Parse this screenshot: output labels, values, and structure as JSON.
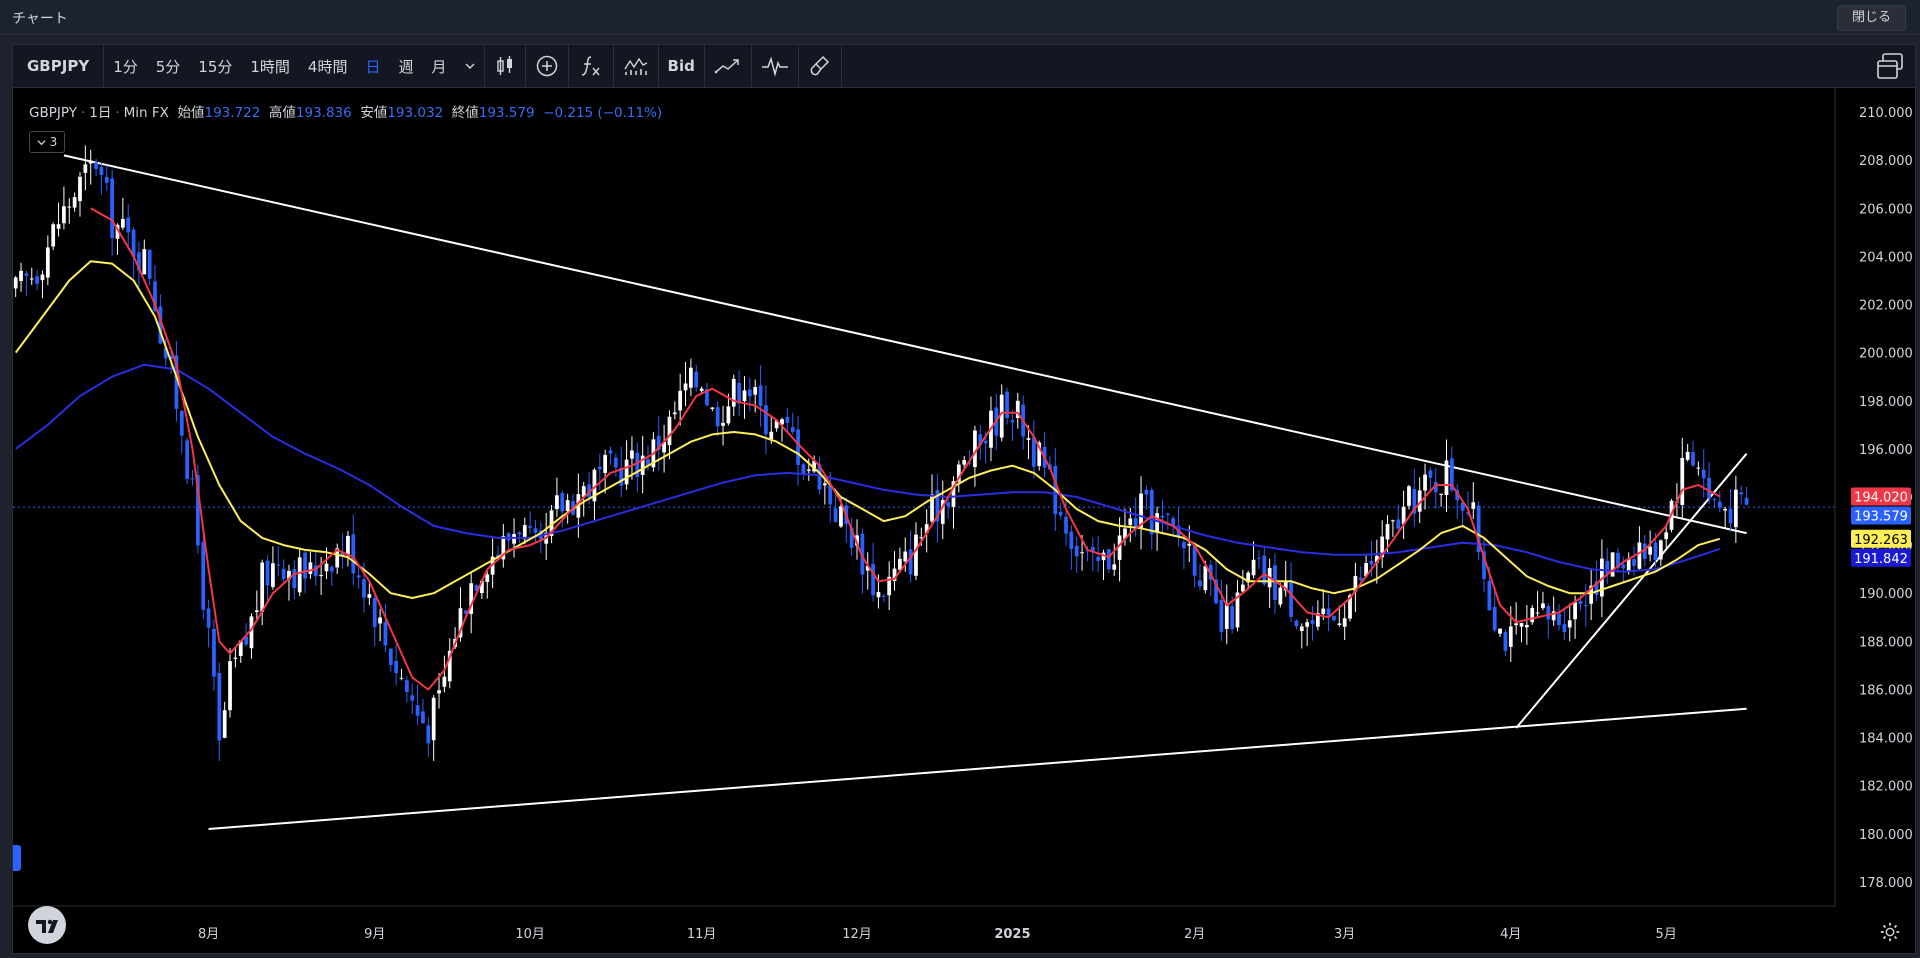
{
  "window": {
    "title": "チャート",
    "close_label": "閉じる"
  },
  "toolbar": {
    "symbol": "GBPJPY",
    "timeframes": [
      "1分",
      "5分",
      "15分",
      "1時間",
      "4時間",
      "日",
      "週",
      "月"
    ],
    "active_timeframe": "日",
    "bid_label": "Bid"
  },
  "legend": {
    "symbol": "GBPJPY",
    "interval": "1日",
    "source": "Min FX",
    "open_label": "始値",
    "open": "193.722",
    "high_label": "高値",
    "high": "193.836",
    "low_label": "安値",
    "low": "193.032",
    "close_label": "終値",
    "close": "193.579",
    "change": "−0.215 (−0.11%)",
    "collapse_count": "3"
  },
  "colors": {
    "up": "#ffffff",
    "down": "#2962ff",
    "ma_fast": "#f23645",
    "ma_mid": "#ffee58",
    "ma_slow": "#2a2ee0",
    "trendline": "#ffffff"
  },
  "chart_data": {
    "type": "candlestick",
    "y_range": [
      177.0,
      211.0
    ],
    "y_ticks": [
      "178.000",
      "180.000",
      "182.000",
      "184.000",
      "186.000",
      "188.000",
      "190.000",
      "192.000",
      "194.000",
      "196.000",
      "198.000",
      "200.000",
      "202.000",
      "204.000",
      "206.000",
      "208.000",
      "210.000"
    ],
    "x_ticks": [
      {
        "label": "7月",
        "bar": 5
      },
      {
        "label": "8月",
        "bar": 36
      },
      {
        "label": "9月",
        "bar": 67
      },
      {
        "label": "10月",
        "bar": 96
      },
      {
        "label": "11月",
        "bar": 128
      },
      {
        "label": "12月",
        "bar": 157
      },
      {
        "label": "2025",
        "bar": 186
      },
      {
        "label": "2月",
        "bar": 220
      },
      {
        "label": "3月",
        "bar": 248
      },
      {
        "label": "4月",
        "bar": 279
      },
      {
        "label": "5月",
        "bar": 308
      }
    ],
    "price_labels": [
      {
        "value": "194.020",
        "price": 194.02,
        "color": "#f23645",
        "text_color": "#ffffff"
      },
      {
        "value": "193.579",
        "price": 193.579,
        "color": "#2962ff",
        "text_color": "#ffffff"
      },
      {
        "value": "192.263",
        "price": 192.263,
        "color": "#ffee58",
        "text_color": "#000000"
      },
      {
        "value": "191.842",
        "price": 191.842,
        "color": "#1a1ad6",
        "text_color": "#ffffff"
      }
    ],
    "last_price": 193.579,
    "close_path": [
      [
        0,
        202.5
      ],
      [
        4,
        203.5
      ],
      [
        8,
        205.5
      ],
      [
        12,
        207.0
      ],
      [
        15,
        208.0
      ],
      [
        18,
        205.5
      ],
      [
        22,
        204.5
      ],
      [
        25,
        203.5
      ],
      [
        27,
        201.0
      ],
      [
        29,
        199.0
      ],
      [
        31,
        197.0
      ],
      [
        33,
        194.0
      ],
      [
        35,
        190.0
      ],
      [
        37,
        186.0
      ],
      [
        38,
        183.5
      ],
      [
        40,
        186.5
      ],
      [
        43,
        188.0
      ],
      [
        46,
        190.5
      ],
      [
        49,
        191.5
      ],
      [
        52,
        191.0
      ],
      [
        55,
        190.8
      ],
      [
        58,
        191.5
      ],
      [
        60,
        191.8
      ],
      [
        62,
        192.0
      ],
      [
        64,
        191.0
      ],
      [
        66,
        190.0
      ],
      [
        69,
        188.0
      ],
      [
        72,
        186.5
      ],
      [
        75,
        185.0
      ],
      [
        77,
        184.5
      ],
      [
        79,
        185.5
      ],
      [
        82,
        188.5
      ],
      [
        85,
        190.5
      ],
      [
        88,
        191.5
      ],
      [
        91,
        192.0
      ],
      [
        94,
        193.0
      ],
      [
        96,
        192.0
      ],
      [
        98,
        191.5
      ],
      [
        101,
        193.5
      ],
      [
        104,
        194.0
      ],
      [
        107,
        194.5
      ],
      [
        110,
        195.0
      ],
      [
        113,
        195.2
      ],
      [
        116,
        195.5
      ],
      [
        119,
        196.0
      ],
      [
        122,
        197.0
      ],
      [
        125,
        198.5
      ],
      [
        128,
        199.0
      ],
      [
        130,
        197.5
      ],
      [
        133,
        198.0
      ],
      [
        136,
        199.0
      ],
      [
        139,
        197.5
      ],
      [
        142,
        197.0
      ],
      [
        145,
        196.5
      ],
      [
        147,
        195.5
      ],
      [
        150,
        195.0
      ],
      [
        153,
        193.5
      ],
      [
        156,
        192.5
      ],
      [
        159,
        191.0
      ],
      [
        161,
        190.0
      ],
      [
        164,
        190.8
      ],
      [
        167,
        191.5
      ],
      [
        170,
        193.0
      ],
      [
        173,
        194.0
      ],
      [
        176,
        195.0
      ],
      [
        179,
        196.0
      ],
      [
        182,
        197.0
      ],
      [
        185,
        198.0
      ],
      [
        188,
        197.0
      ],
      [
        190,
        196.0
      ],
      [
        192,
        195.0
      ],
      [
        195,
        193.5
      ],
      [
        198,
        192.0
      ],
      [
        201,
        191.0
      ],
      [
        204,
        191.5
      ],
      [
        207,
        192.5
      ],
      [
        210,
        193.5
      ],
      [
        213,
        193.0
      ],
      [
        216,
        192.5
      ],
      [
        219,
        192.0
      ],
      [
        222,
        190.5
      ],
      [
        225,
        188.5
      ],
      [
        228,
        189.5
      ],
      [
        231,
        191.0
      ],
      [
        234,
        190.5
      ],
      [
        237,
        190.0
      ],
      [
        240,
        189.0
      ],
      [
        243,
        188.5
      ],
      [
        246,
        189.0
      ],
      [
        249,
        190.0
      ],
      [
        252,
        191.0
      ],
      [
        255,
        192.0
      ],
      [
        258,
        193.0
      ],
      [
        261,
        194.0
      ],
      [
        264,
        194.5
      ],
      [
        267,
        195.0
      ],
      [
        270,
        194.0
      ],
      [
        272,
        193.0
      ],
      [
        275,
        190.0
      ],
      [
        277,
        188.5
      ],
      [
        279,
        188.0
      ],
      [
        282,
        188.5
      ],
      [
        285,
        189.0
      ],
      [
        288,
        189.0
      ],
      [
        291,
        189.5
      ],
      [
        294,
        190.5
      ],
      [
        297,
        191.0
      ],
      [
        300,
        191.5
      ],
      [
        303,
        192.0
      ],
      [
        305,
        191.5
      ],
      [
        307,
        192.5
      ],
      [
        310,
        194.5
      ],
      [
        312,
        196.0
      ],
      [
        314,
        195.5
      ],
      [
        316,
        194.0
      ],
      [
        318,
        193.6
      ]
    ],
    "ma_fast_path": [
      [
        14,
        206.0
      ],
      [
        18,
        205.5
      ],
      [
        22,
        204.0
      ],
      [
        26,
        202.0
      ],
      [
        30,
        199.5
      ],
      [
        33,
        196.0
      ],
      [
        36,
        191.0
      ],
      [
        38,
        188.0
      ],
      [
        40,
        187.5
      ],
      [
        44,
        188.5
      ],
      [
        48,
        190.0
      ],
      [
        52,
        190.8
      ],
      [
        56,
        191.0
      ],
      [
        60,
        191.8
      ],
      [
        63,
        191.5
      ],
      [
        66,
        190.5
      ],
      [
        70,
        188.5
      ],
      [
        74,
        186.5
      ],
      [
        77,
        186.0
      ],
      [
        80,
        186.8
      ],
      [
        84,
        189.0
      ],
      [
        88,
        191.0
      ],
      [
        92,
        191.8
      ],
      [
        96,
        192.0
      ],
      [
        99,
        192.3
      ],
      [
        103,
        193.3
      ],
      [
        107,
        194.2
      ],
      [
        111,
        195.0
      ],
      [
        115,
        195.3
      ],
      [
        119,
        195.8
      ],
      [
        123,
        196.8
      ],
      [
        127,
        198.2
      ],
      [
        130,
        198.5
      ],
      [
        134,
        198.0
      ],
      [
        138,
        197.8
      ],
      [
        142,
        197.2
      ],
      [
        146,
        196.2
      ],
      [
        150,
        195.3
      ],
      [
        154,
        193.8
      ],
      [
        158,
        191.5
      ],
      [
        161,
        190.5
      ],
      [
        164,
        190.6
      ],
      [
        168,
        191.8
      ],
      [
        172,
        193.2
      ],
      [
        176,
        194.8
      ],
      [
        180,
        196.2
      ],
      [
        184,
        197.5
      ],
      [
        187,
        197.5
      ],
      [
        190,
        196.5
      ],
      [
        193,
        195.2
      ],
      [
        196,
        193.5
      ],
      [
        200,
        191.8
      ],
      [
        204,
        191.5
      ],
      [
        208,
        192.5
      ],
      [
        212,
        193.2
      ],
      [
        216,
        192.8
      ],
      [
        220,
        192.0
      ],
      [
        223,
        190.8
      ],
      [
        226,
        189.5
      ],
      [
        229,
        190.0
      ],
      [
        233,
        190.8
      ],
      [
        237,
        190.2
      ],
      [
        241,
        189.2
      ],
      [
        245,
        189.0
      ],
      [
        249,
        189.8
      ],
      [
        253,
        191.0
      ],
      [
        257,
        192.2
      ],
      [
        261,
        193.5
      ],
      [
        265,
        194.5
      ],
      [
        268,
        194.5
      ],
      [
        271,
        193.5
      ],
      [
        274,
        191.5
      ],
      [
        277,
        189.5
      ],
      [
        280,
        188.8
      ],
      [
        284,
        189.0
      ],
      [
        288,
        189.2
      ],
      [
        292,
        189.8
      ],
      [
        296,
        190.6
      ],
      [
        300,
        191.3
      ],
      [
        304,
        191.8
      ],
      [
        308,
        192.8
      ],
      [
        311,
        194.3
      ],
      [
        314,
        194.5
      ],
      [
        318,
        194.02
      ]
    ],
    "ma_mid_path": [
      [
        0,
        200.0
      ],
      [
        5,
        201.5
      ],
      [
        10,
        203.0
      ],
      [
        14,
        203.8
      ],
      [
        18,
        203.7
      ],
      [
        22,
        203.0
      ],
      [
        26,
        201.5
      ],
      [
        30,
        199.0
      ],
      [
        34,
        196.5
      ],
      [
        38,
        194.5
      ],
      [
        42,
        193.0
      ],
      [
        46,
        192.3
      ],
      [
        50,
        192.0
      ],
      [
        54,
        191.8
      ],
      [
        58,
        191.7
      ],
      [
        62,
        191.5
      ],
      [
        66,
        190.8
      ],
      [
        70,
        190.0
      ],
      [
        74,
        189.8
      ],
      [
        78,
        190.0
      ],
      [
        82,
        190.5
      ],
      [
        86,
        191.0
      ],
      [
        90,
        191.5
      ],
      [
        94,
        192.0
      ],
      [
        98,
        192.5
      ],
      [
        102,
        193.2
      ],
      [
        106,
        193.8
      ],
      [
        110,
        194.3
      ],
      [
        114,
        194.8
      ],
      [
        118,
        195.3
      ],
      [
        122,
        195.8
      ],
      [
        126,
        196.3
      ],
      [
        130,
        196.6
      ],
      [
        134,
        196.7
      ],
      [
        138,
        196.6
      ],
      [
        142,
        196.3
      ],
      [
        146,
        195.8
      ],
      [
        150,
        195.0
      ],
      [
        154,
        194.0
      ],
      [
        158,
        193.5
      ],
      [
        162,
        193.0
      ],
      [
        166,
        193.2
      ],
      [
        170,
        193.8
      ],
      [
        174,
        194.3
      ],
      [
        178,
        194.8
      ],
      [
        182,
        195.1
      ],
      [
        186,
        195.3
      ],
      [
        190,
        195.0
      ],
      [
        194,
        194.3
      ],
      [
        198,
        193.5
      ],
      [
        202,
        193.0
      ],
      [
        206,
        192.8
      ],
      [
        210,
        192.7
      ],
      [
        214,
        192.5
      ],
      [
        218,
        192.3
      ],
      [
        222,
        191.8
      ],
      [
        226,
        191.0
      ],
      [
        230,
        190.5
      ],
      [
        234,
        190.5
      ],
      [
        238,
        190.5
      ],
      [
        242,
        190.2
      ],
      [
        246,
        190.0
      ],
      [
        250,
        190.2
      ],
      [
        254,
        190.6
      ],
      [
        258,
        191.2
      ],
      [
        262,
        191.8
      ],
      [
        266,
        192.5
      ],
      [
        270,
        192.8
      ],
      [
        274,
        192.3
      ],
      [
        278,
        191.5
      ],
      [
        282,
        190.7
      ],
      [
        286,
        190.3
      ],
      [
        290,
        190.0
      ],
      [
        294,
        190.0
      ],
      [
        298,
        190.3
      ],
      [
        302,
        190.6
      ],
      [
        306,
        190.9
      ],
      [
        310,
        191.4
      ],
      [
        314,
        192.0
      ],
      [
        318,
        192.263
      ]
    ],
    "ma_slow_path": [
      [
        0,
        196.0
      ],
      [
        6,
        197.0
      ],
      [
        12,
        198.2
      ],
      [
        18,
        199.0
      ],
      [
        24,
        199.5
      ],
      [
        30,
        199.3
      ],
      [
        36,
        198.5
      ],
      [
        42,
        197.5
      ],
      [
        48,
        196.5
      ],
      [
        54,
        195.8
      ],
      [
        60,
        195.2
      ],
      [
        66,
        194.5
      ],
      [
        72,
        193.6
      ],
      [
        78,
        192.8
      ],
      [
        84,
        192.5
      ],
      [
        90,
        192.3
      ],
      [
        96,
        192.3
      ],
      [
        102,
        192.6
      ],
      [
        108,
        193.0
      ],
      [
        114,
        193.4
      ],
      [
        120,
        193.8
      ],
      [
        126,
        194.2
      ],
      [
        132,
        194.6
      ],
      [
        138,
        194.9
      ],
      [
        144,
        195.0
      ],
      [
        150,
        194.9
      ],
      [
        156,
        194.6
      ],
      [
        162,
        194.3
      ],
      [
        168,
        194.1
      ],
      [
        174,
        194.0
      ],
      [
        180,
        194.1
      ],
      [
        186,
        194.2
      ],
      [
        192,
        194.2
      ],
      [
        198,
        194.0
      ],
      [
        204,
        193.6
      ],
      [
        210,
        193.2
      ],
      [
        216,
        192.8
      ],
      [
        222,
        192.4
      ],
      [
        228,
        192.1
      ],
      [
        234,
        191.9
      ],
      [
        240,
        191.7
      ],
      [
        246,
        191.6
      ],
      [
        252,
        191.6
      ],
      [
        258,
        191.7
      ],
      [
        264,
        191.9
      ],
      [
        270,
        192.1
      ],
      [
        276,
        192.0
      ],
      [
        282,
        191.7
      ],
      [
        288,
        191.3
      ],
      [
        294,
        191.0
      ],
      [
        300,
        190.9
      ],
      [
        306,
        191.0
      ],
      [
        312,
        191.4
      ],
      [
        318,
        191.842
      ]
    ],
    "trendlines": [
      {
        "from": [
          9,
          208.2
        ],
        "to": [
          323,
          192.5
        ]
      },
      {
        "from": [
          36,
          180.2
        ],
        "to": [
          323,
          185.2
        ]
      },
      {
        "from": [
          280,
          184.4
        ],
        "to": [
          323,
          195.8
        ]
      }
    ],
    "bar_count": 324
  }
}
